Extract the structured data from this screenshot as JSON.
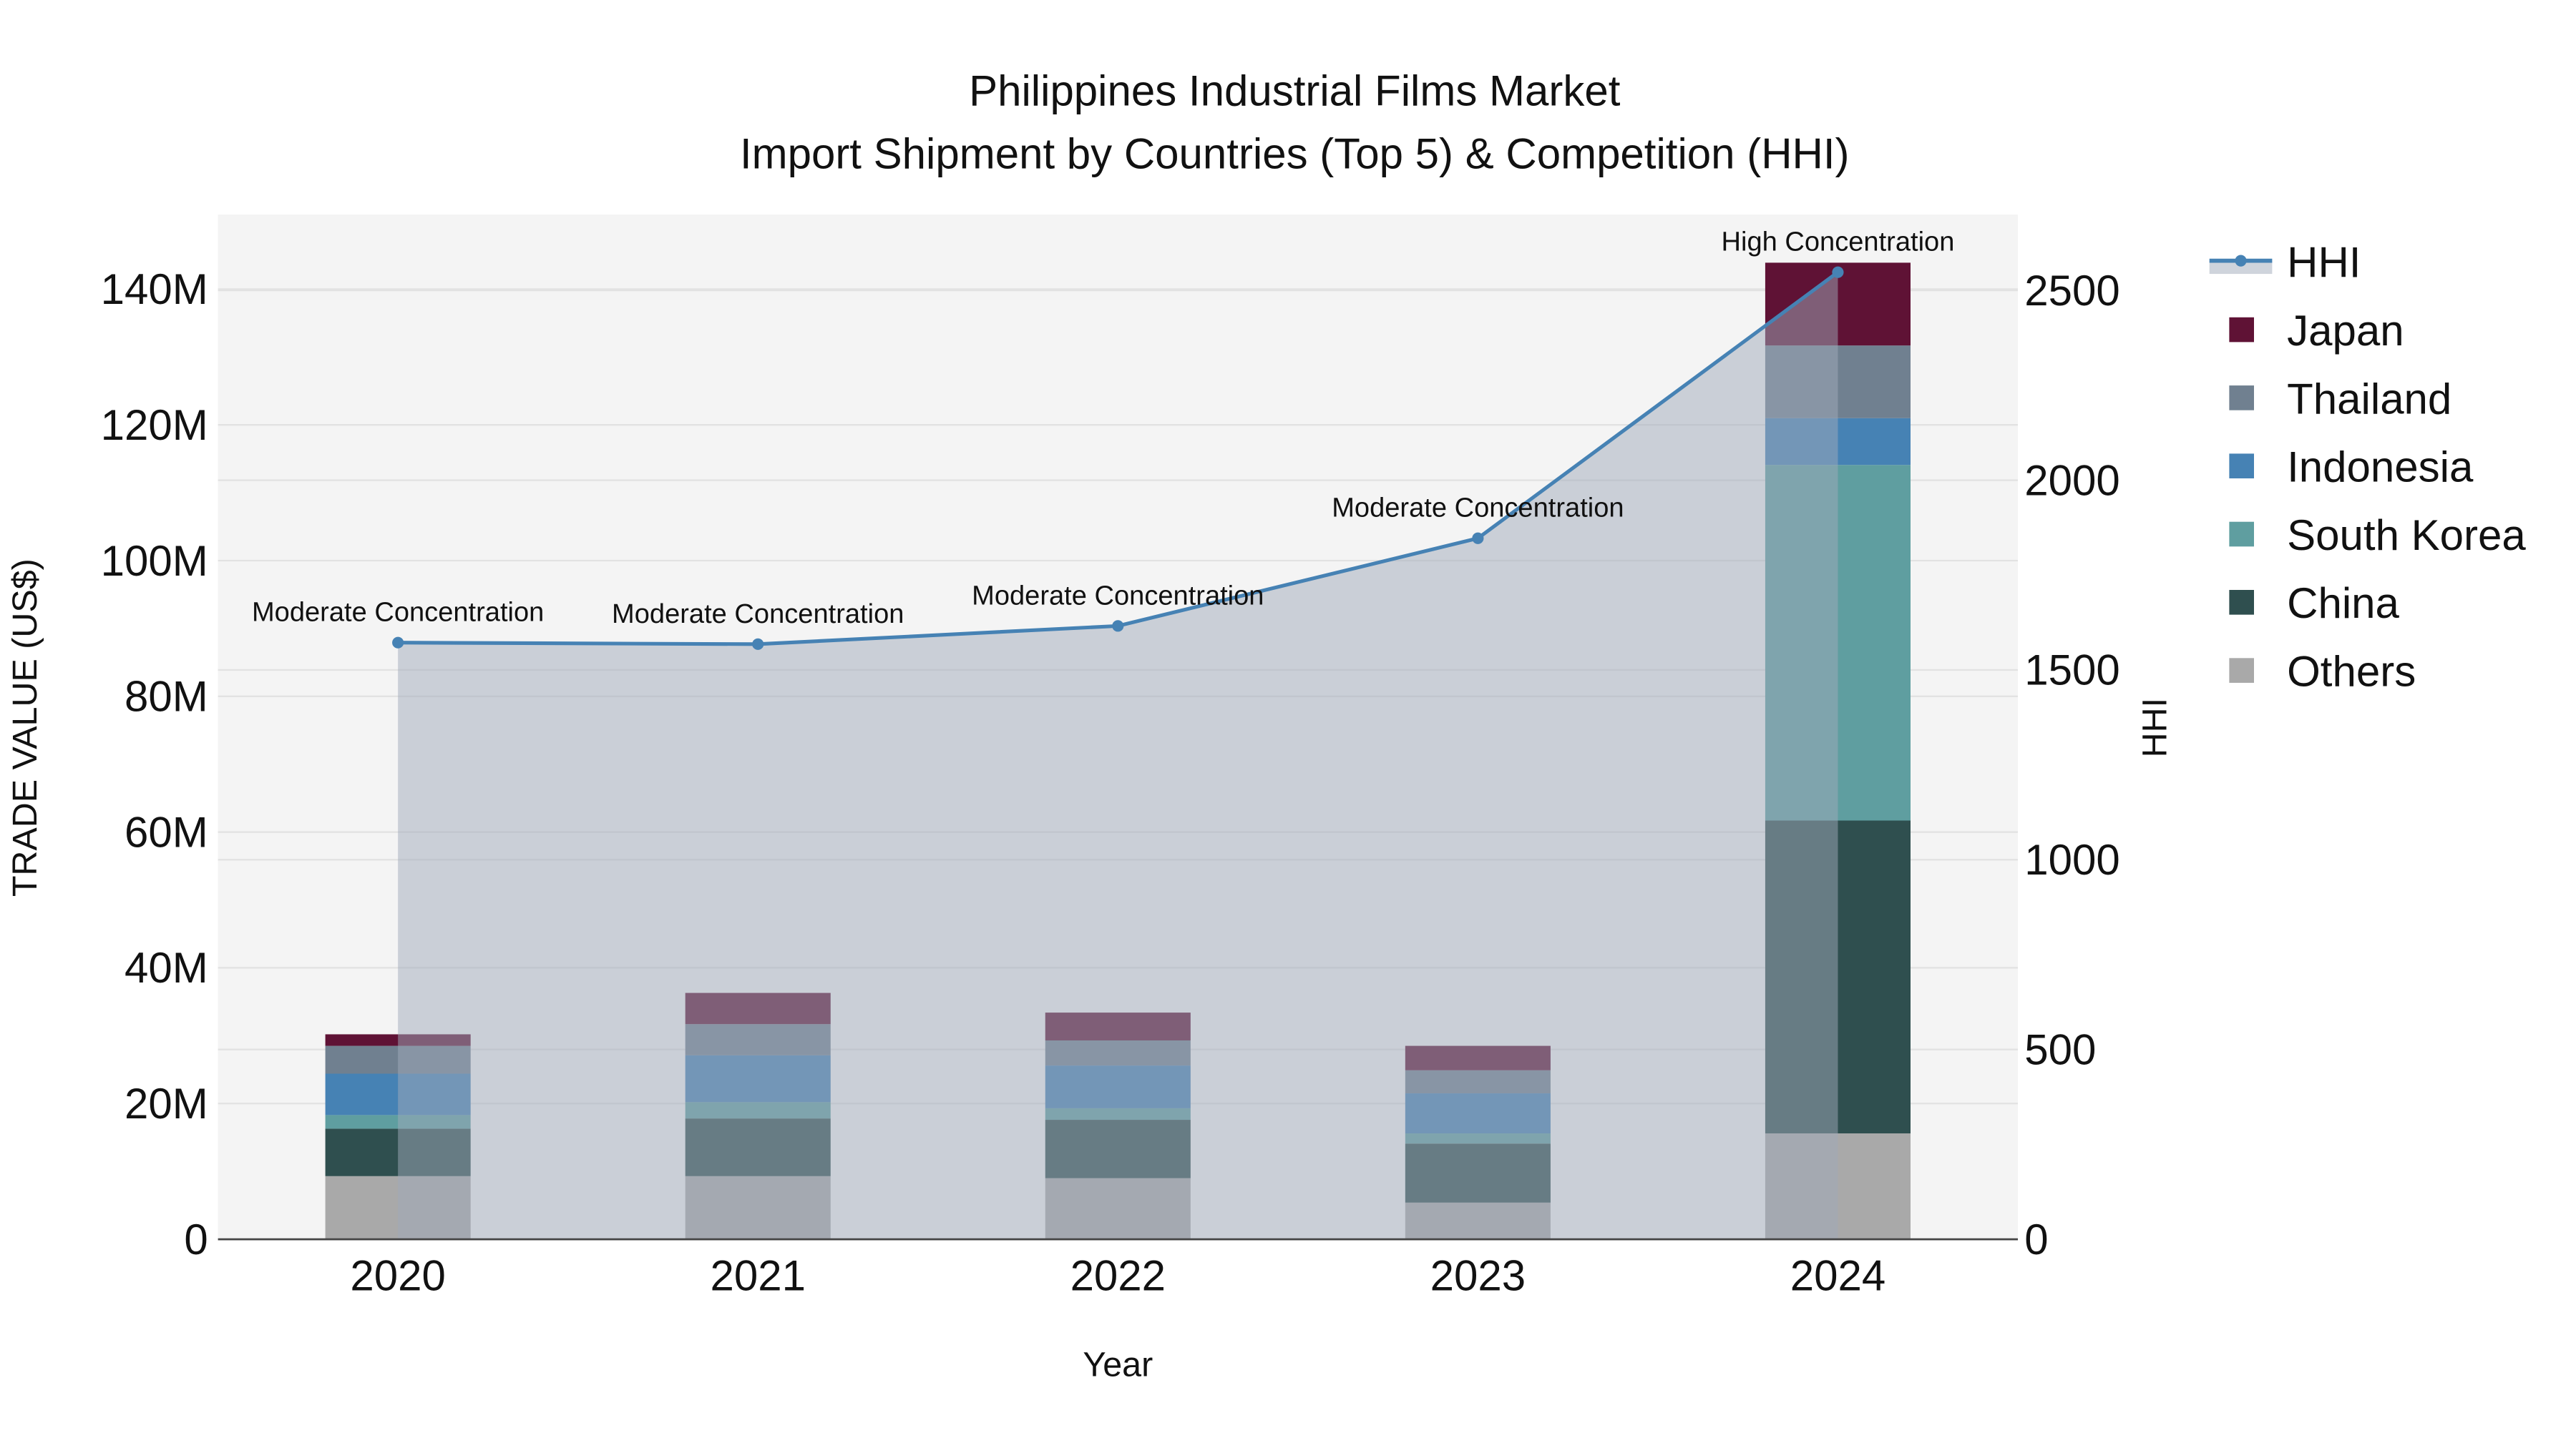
{
  "chart_data": {
    "type": "bar",
    "title": "Philippines Industrial Films Market",
    "subtitle": "Import Shipment by Countries (Top 5) & Competition (HHI)",
    "xlabel": "Year",
    "ylabel": "TRADE VALUE (US$)",
    "y2label": "HHI",
    "categories": [
      "2020",
      "2021",
      "2022",
      "2023",
      "2024"
    ],
    "ylim": [
      0,
      151000000
    ],
    "y_ticks": [
      0,
      20000000,
      40000000,
      60000000,
      80000000,
      100000000,
      120000000,
      140000000
    ],
    "y_tick_labels": [
      "0",
      "20M",
      "40M",
      "60M",
      "80M",
      "100M",
      "120M",
      "140M"
    ],
    "y2lim": [
      0,
      2700
    ],
    "y2_ticks": [
      0,
      500,
      1000,
      1500,
      2000,
      2500
    ],
    "y2_tick_labels": [
      "0",
      "500",
      "1000",
      "1500",
      "2000",
      "2500"
    ],
    "grid": true,
    "legend_position": "right",
    "series": [
      {
        "name": "Others",
        "color": "#a9a9a9",
        "values": [
          9.3,
          9.3,
          9.0,
          5.4,
          15.6
        ]
      },
      {
        "name": "China",
        "color": "#2f4f4f",
        "values": [
          7.0,
          8.5,
          8.6,
          8.7,
          46.1
        ]
      },
      {
        "name": "South Korea",
        "color": "#5f9ea0",
        "values": [
          2.0,
          2.4,
          1.7,
          1.5,
          52.4
        ]
      },
      {
        "name": "Indonesia",
        "color": "#4682b4",
        "values": [
          6.1,
          6.9,
          6.3,
          5.9,
          6.9
        ]
      },
      {
        "name": "Thailand",
        "color": "#708090",
        "values": [
          4.1,
          4.6,
          3.7,
          3.4,
          10.7
        ]
      },
      {
        "name": "Japan",
        "color": "#5f1235",
        "values": [
          1.7,
          4.6,
          4.1,
          3.6,
          12.2
        ]
      }
    ],
    "value_unit": "million US$",
    "hhi": {
      "name": "HHI",
      "color": "#4682b4",
      "values": [
        1572,
        1568,
        1616,
        1847,
        2548
      ],
      "labels": [
        "Moderate Concentration",
        "Moderate Concentration",
        "Moderate Concentration",
        "Moderate Concentration",
        "High Concentration"
      ]
    },
    "legend": [
      "HHI",
      "Japan",
      "Thailand",
      "Indonesia",
      "South Korea",
      "China",
      "Others"
    ]
  }
}
